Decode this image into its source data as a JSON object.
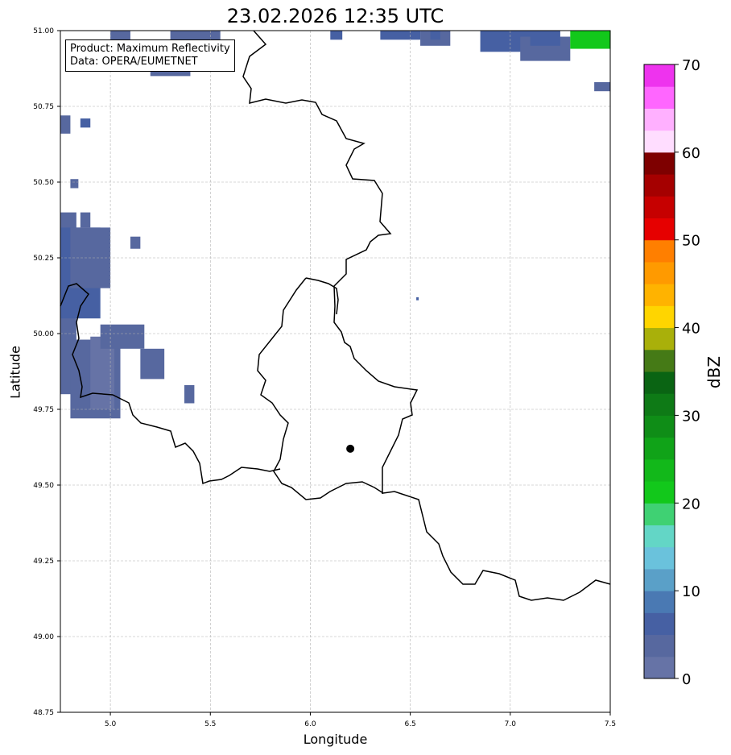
{
  "title": "23.02.2026 12:35 UTC",
  "info_box": {
    "line1": "Product: Maximum Reflectivity",
    "line2": "Data: OPERA/EUMETNET"
  },
  "axes": {
    "xlabel": "Longitude",
    "ylabel": "Latitude",
    "xlim": [
      4.75,
      7.5
    ],
    "ylim": [
      48.75,
      51.0
    ],
    "xticks": [
      5.0,
      5.5,
      6.0,
      6.5,
      7.0,
      7.5
    ],
    "xtick_labels": [
      "5.0",
      "5.5",
      "6.0",
      "6.5",
      "7.0",
      "7.5"
    ],
    "yticks": [
      48.75,
      49.0,
      49.25,
      49.5,
      49.75,
      50.0,
      50.25,
      50.5,
      50.75,
      51.0
    ],
    "ytick_labels": [
      "48.75",
      "49.00",
      "49.25",
      "49.50",
      "49.75",
      "50.00",
      "50.25",
      "50.50",
      "50.75",
      "51.00"
    ],
    "grid": true
  },
  "colorbar": {
    "label": "dBZ",
    "range": [
      0,
      70
    ],
    "ticks": [
      0,
      10,
      20,
      30,
      40,
      50,
      60,
      70
    ],
    "tick_labels": [
      "0",
      "10",
      "20",
      "30",
      "40",
      "50",
      "60",
      "70"
    ],
    "colors": [
      "#6673a6",
      "#57689f",
      "#4660a3",
      "#4a79b3",
      "#5aa0c8",
      "#6ac2dc",
      "#63d6c6",
      "#3fd173",
      "#12c81b",
      "#12b81a",
      "#10a318",
      "#0f8d17",
      "#0e7a16",
      "#0a6413",
      "#457a16",
      "#a9b00a",
      "#ffd500",
      "#ffb300",
      "#ff9a00",
      "#ff7f00",
      "#e60000",
      "#c60000",
      "#a50000",
      "#7e0000",
      "#ffddff",
      "#ffb0ff",
      "#ff66ff",
      "#ee33ee"
    ]
  },
  "marker": {
    "lon": 6.2,
    "lat": 49.62
  },
  "reflectivity_cells": [
    {
      "lon": 4.75,
      "lat": 49.8,
      "w": 0.08,
      "h": 0.6,
      "dbz": 3
    },
    {
      "lon": 4.8,
      "lat": 49.72,
      "w": 0.25,
      "h": 0.26,
      "dbz": 3
    },
    {
      "lon": 4.9,
      "lat": 49.75,
      "w": 0.12,
      "h": 0.24,
      "dbz": 2
    },
    {
      "lon": 4.75,
      "lat": 50.05,
      "w": 0.2,
      "h": 0.3,
      "dbz": 5
    },
    {
      "lon": 4.8,
      "lat": 50.15,
      "w": 0.2,
      "h": 0.2,
      "dbz": 3
    },
    {
      "lon": 4.85,
      "lat": 50.35,
      "w": 0.05,
      "h": 0.05,
      "dbz": 3
    },
    {
      "lon": 4.95,
      "lat": 49.95,
      "w": 0.22,
      "h": 0.08,
      "dbz": 3
    },
    {
      "lon": 5.15,
      "lat": 49.85,
      "w": 0.12,
      "h": 0.1,
      "dbz": 3
    },
    {
      "lon": 5.37,
      "lat": 49.77,
      "w": 0.05,
      "h": 0.06,
      "dbz": 3
    },
    {
      "lon": 4.75,
      "lat": 50.66,
      "w": 0.05,
      "h": 0.06,
      "dbz": 4
    },
    {
      "lon": 4.85,
      "lat": 50.68,
      "w": 0.05,
      "h": 0.03,
      "dbz": 7
    },
    {
      "lon": 4.8,
      "lat": 50.48,
      "w": 0.04,
      "h": 0.03,
      "dbz": 3
    },
    {
      "lon": 5.1,
      "lat": 50.28,
      "w": 0.05,
      "h": 0.04,
      "dbz": 3
    },
    {
      "lon": 5.0,
      "lat": 50.97,
      "w": 0.1,
      "h": 0.03,
      "dbz": 3
    },
    {
      "lon": 5.2,
      "lat": 50.85,
      "w": 0.2,
      "h": 0.03,
      "dbz": 3
    },
    {
      "lon": 5.3,
      "lat": 50.97,
      "w": 0.25,
      "h": 0.03,
      "dbz": 4
    },
    {
      "lon": 6.1,
      "lat": 50.97,
      "w": 0.06,
      "h": 0.03,
      "dbz": 5
    },
    {
      "lon": 6.35,
      "lat": 50.97,
      "w": 0.2,
      "h": 0.03,
      "dbz": 6
    },
    {
      "lon": 6.55,
      "lat": 50.95,
      "w": 0.15,
      "h": 0.05,
      "dbz": 4
    },
    {
      "lon": 6.6,
      "lat": 50.97,
      "w": 0.05,
      "h": 0.03,
      "dbz": 7
    },
    {
      "lon": 6.85,
      "lat": 50.93,
      "w": 0.3,
      "h": 0.07,
      "dbz": 5
    },
    {
      "lon": 7.05,
      "lat": 50.9,
      "w": 0.25,
      "h": 0.08,
      "dbz": 4
    },
    {
      "lon": 7.1,
      "lat": 50.95,
      "w": 0.15,
      "h": 0.05,
      "dbz": 7
    },
    {
      "lon": 7.3,
      "lat": 50.94,
      "w": 0.2,
      "h": 0.06,
      "dbz": 22
    },
    {
      "lon": 7.42,
      "lat": 50.8,
      "w": 0.08,
      "h": 0.03,
      "dbz": 4
    },
    {
      "lon": 6.53,
      "lat": 50.11,
      "w": 0.01,
      "h": 0.01,
      "dbz": 5
    }
  ]
}
